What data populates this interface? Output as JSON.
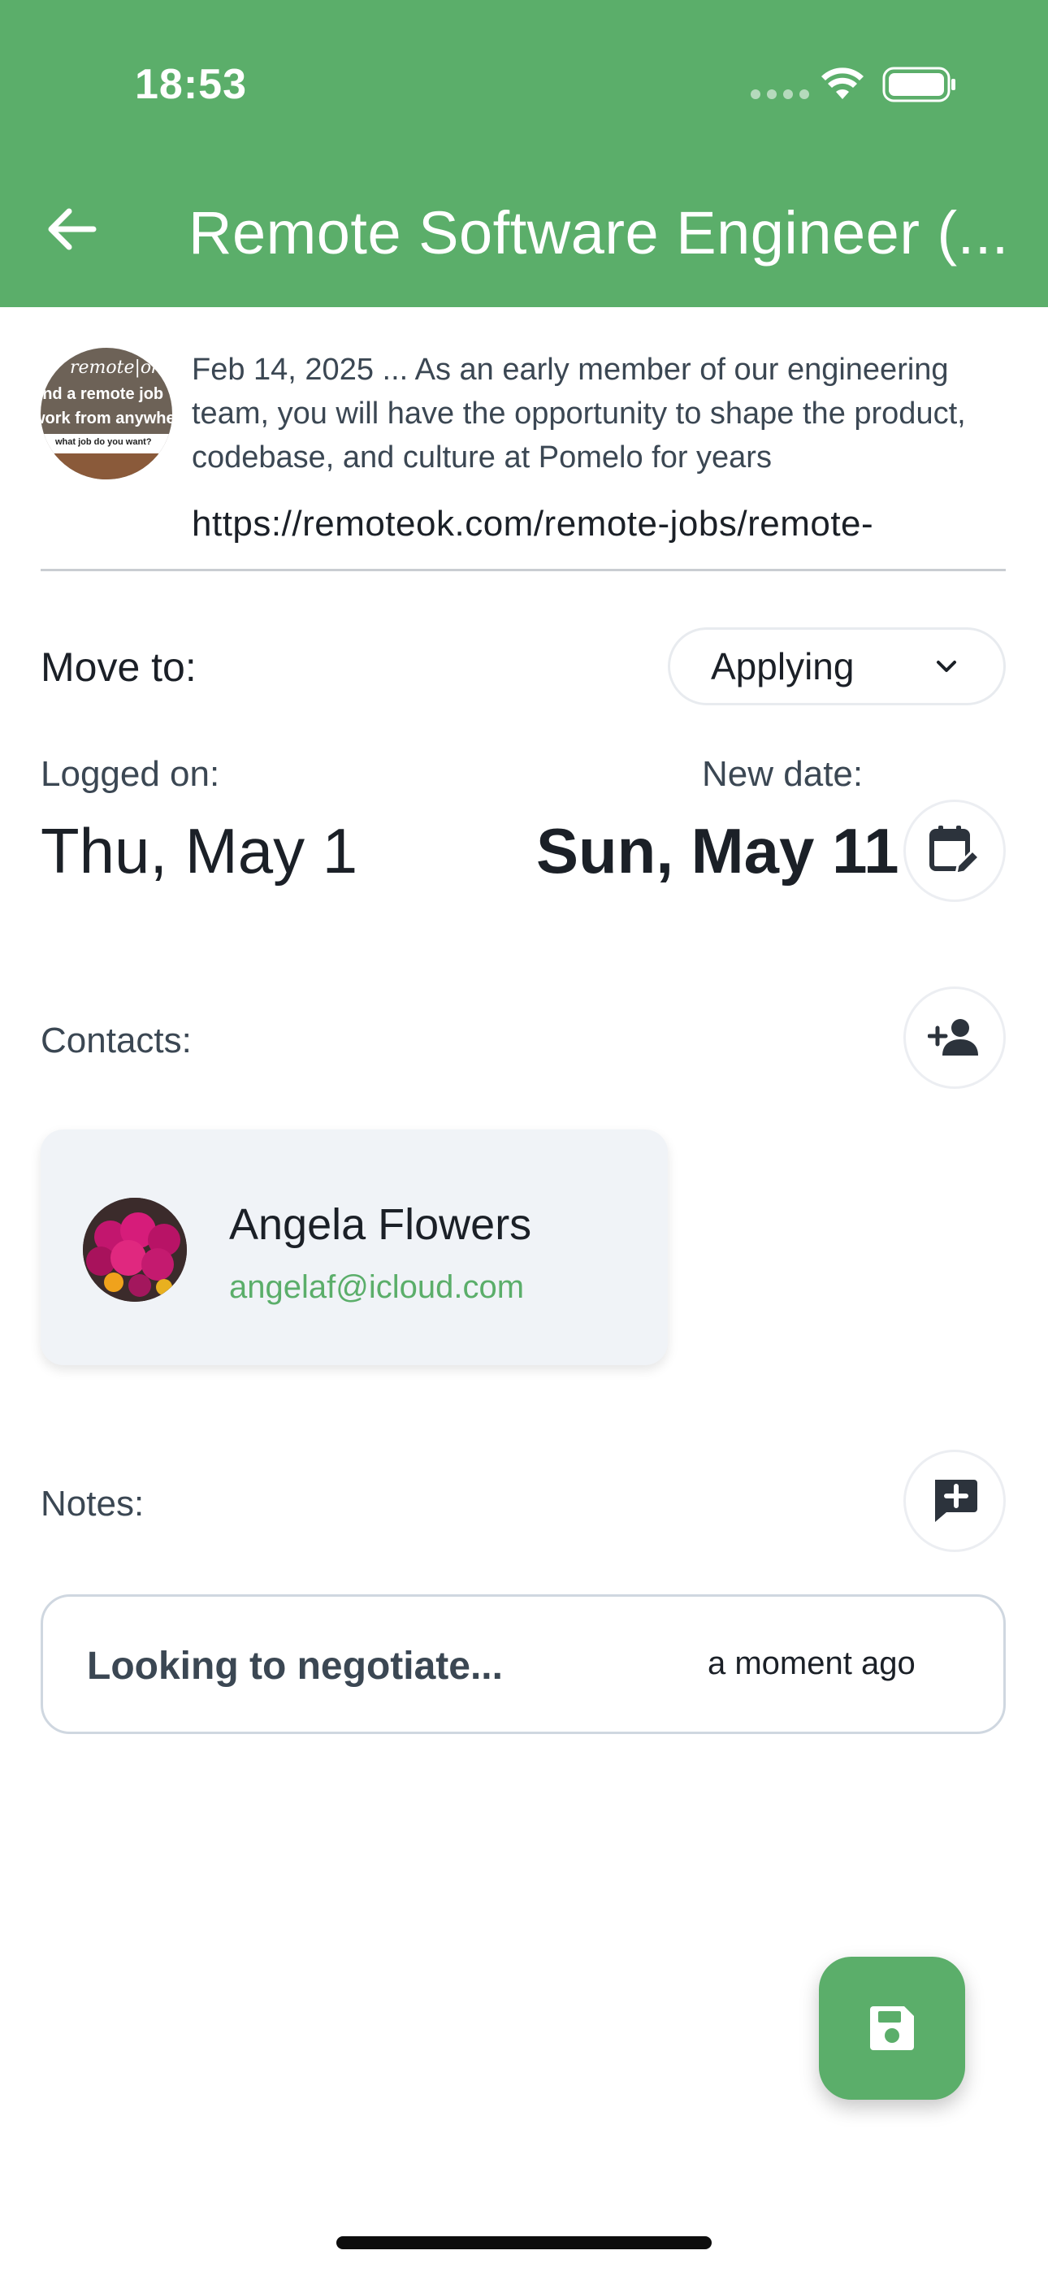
{
  "status_bar": {
    "time": "18:53"
  },
  "appbar": {
    "title": "Remote Software Engineer (..."
  },
  "job": {
    "thumbnail_text": {
      "brand": "remote|ok",
      "line1": "find a remote job",
      "line2": "work from anywhere",
      "tagline": "what job do you want?"
    },
    "description": "Feb 14, 2025 ... As an early member of our engineering team, you will have the opportunity to shape the product, codebase, and culture at Pomelo for years",
    "url": "https://remoteok.com/remote-jobs/remote-"
  },
  "move_to": {
    "label": "Move to:",
    "selected": "Applying"
  },
  "dates": {
    "logged_label": "Logged on:",
    "logged_value": "Thu, May 1",
    "new_label": "New date:",
    "new_value": "Sun, May 11"
  },
  "contacts": {
    "label": "Contacts:",
    "items": [
      {
        "name": "Angela Flowers",
        "email": "angelaf@icloud.com"
      }
    ]
  },
  "notes": {
    "label": "Notes:",
    "items": [
      {
        "text": "Looking to negotiate...",
        "time": "a moment ago"
      }
    ]
  },
  "colors": {
    "primary": "#5bae6a",
    "card_bg": "#f0f3f7",
    "text_dark": "#1b2027",
    "text_muted": "#3b4753"
  },
  "icons": {
    "back": "arrow-left-icon",
    "calendar": "calendar-edit-icon",
    "add_contact": "person-add-icon",
    "add_note": "comment-plus-icon",
    "save": "floppy-disk-icon",
    "dropdown": "chevron-down-icon"
  }
}
